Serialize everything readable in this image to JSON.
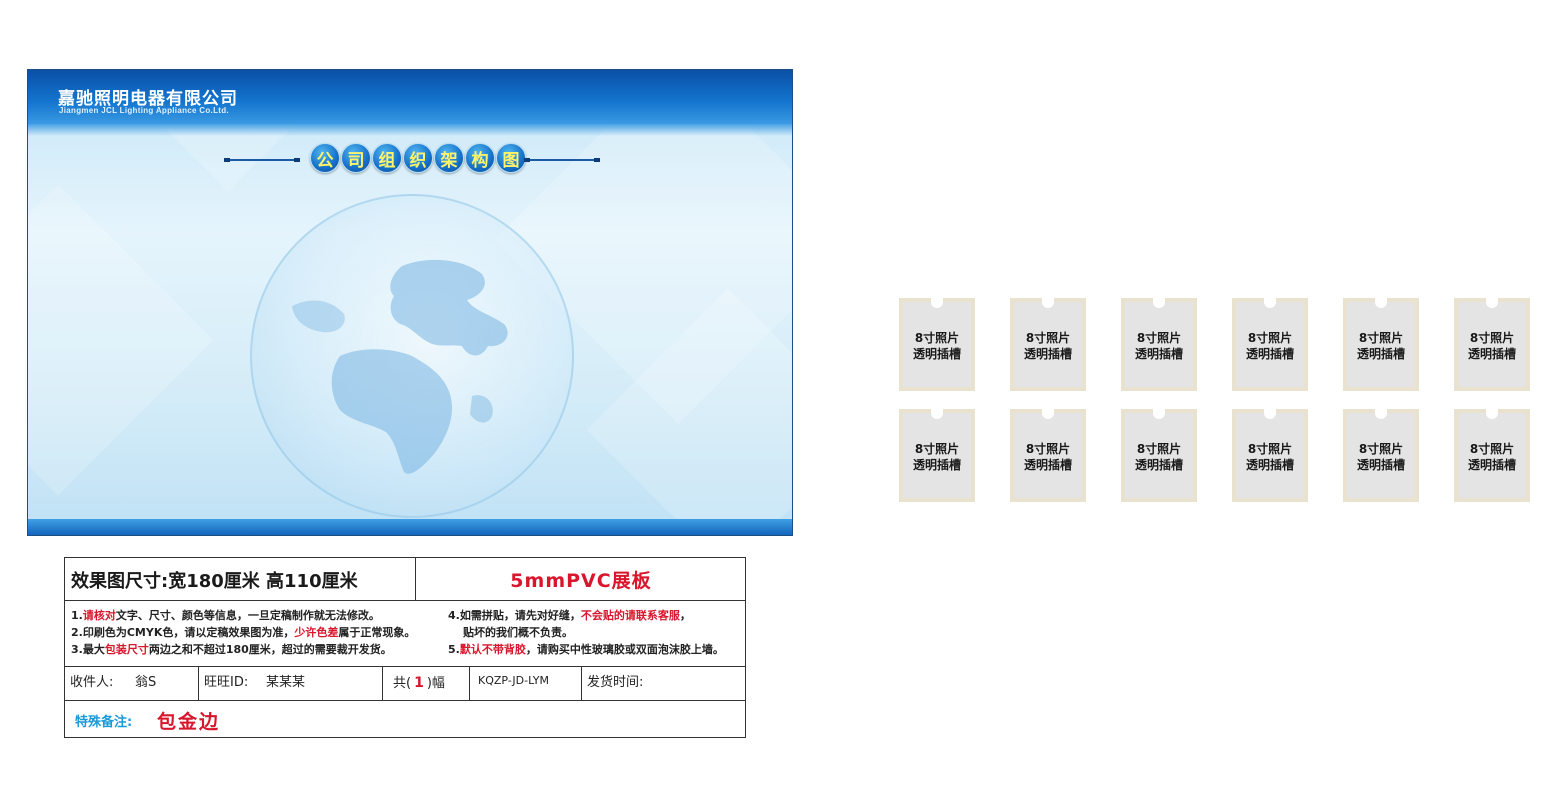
{
  "board": {
    "company_cn": "嘉驰照明电器有限公司",
    "company_en": "Jiangmen JCL Lighting Appliance Co.Ltd.",
    "title_chars": [
      "公",
      "司",
      "组",
      "织",
      "架",
      "构",
      "图"
    ],
    "colors": {
      "header_blue": "#1476cf",
      "title_text": "#fff36a",
      "background_light": "#d4ecf8"
    }
  },
  "info": {
    "size_label": "效果图尺寸:宽180厘米  高110厘米",
    "material": "5mmPVC展板",
    "notes": {
      "n1_prefix": "1.",
      "n1_red": "请核对",
      "n1_rest": "文字、尺寸、颜色等信息，一旦定稿制作就无法修改。",
      "n2_prefix": "2.印刷色为CMYK色，请以定稿效果图为准，",
      "n2_red": "少许色差",
      "n2_rest": "属于正常现象。",
      "n3_prefix": "3.最大",
      "n3_red": "包装尺寸",
      "n3_rest": "两边之和不超过180厘米，超过的需要裁开发货。",
      "n4_prefix": "4.如需拼贴，请先对好缝，",
      "n4_red": "不会贴的请联系客服",
      "n4_rest": "，",
      "n4_line2": "贴坏的我们概不负责。",
      "n5_prefix": "5.",
      "n5_red": "默认不带背胶",
      "n5_rest": "，请购买中性玻璃胶或双面泡沫胶上墙。"
    },
    "receiver_label": "收件人:",
    "receiver_value": "翁S",
    "wangwang_label": "旺旺ID:",
    "wangwang_value": "某某某",
    "count_prefix": "共(",
    "count_value": "1",
    "count_suffix": ")幅",
    "order_code": "KQZP-JD-LYM",
    "ship_time_label": "发货时间:",
    "remark_label": "特殊备注:",
    "remark_value": "包金边",
    "colors": {
      "accent_red": "#d8162c",
      "remark_blue": "#1b9ad8"
    }
  },
  "slots": {
    "line1": "8寸照片",
    "line2": "透明插槽",
    "rows": 2,
    "cols": 6
  }
}
